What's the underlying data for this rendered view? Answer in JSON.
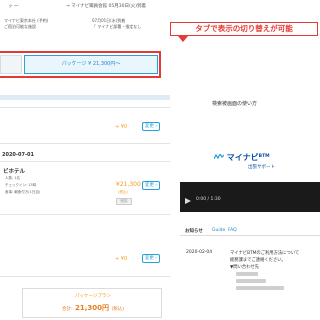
{
  "topline": {
    "left": "ッ 一",
    "right": "→ マイナビ職員会館 05月30日(火)到着"
  },
  "info": {
    "line1": "マイナビ東京本社 (予約)",
    "line1b": "07月01日(水)到着",
    "line2": "ご宿泊可能な施設",
    "line2b": "「 マイナビ部署・指定なし"
  },
  "callout": "タブで表示の切り替えが可能",
  "tabs": {
    "package_label": "パッケージ ¥ 21,300円〜"
  },
  "rows": [
    {
      "plus": "+ ¥0",
      "change": "変更 ›"
    },
    {
      "date": "2020-07-01"
    },
    {
      "hotel": "ビホテル",
      "detail1": "人数: 1名",
      "detail2": "チェックイン: 15時",
      "detail3": "食事: 朝食付き(1日目)",
      "price": "¥21,300",
      "tax": "(税込)",
      "change": "変更 ›",
      "deleted": "削除"
    },
    {
      "plus": "+ ¥0",
      "change": "変更 ›"
    }
  ],
  "total": {
    "label": "パッケージプラン",
    "prefix": "合計:",
    "amount": "21,300円",
    "tax": "(税込)"
  },
  "right": {
    "guide_title": "検索被画面の使い方",
    "logo": "マイナビ",
    "logo_btm": "BTM",
    "logo_sub": "出張サポート",
    "video_time": "0:00 / 1:30",
    "tabs": [
      "お知らせ",
      "Guide",
      "FAQ"
    ],
    "news_date": "2020-02-04",
    "news_lines": [
      "マイナビBTMのご利用方法について",
      "総務課までご連絡ください。",
      "▼問い合わせ先"
    ]
  },
  "colors": {
    "accent": "#29a0d8",
    "callout": "#e53935",
    "price": "#f39c12",
    "brand": "#0b4ea2"
  }
}
